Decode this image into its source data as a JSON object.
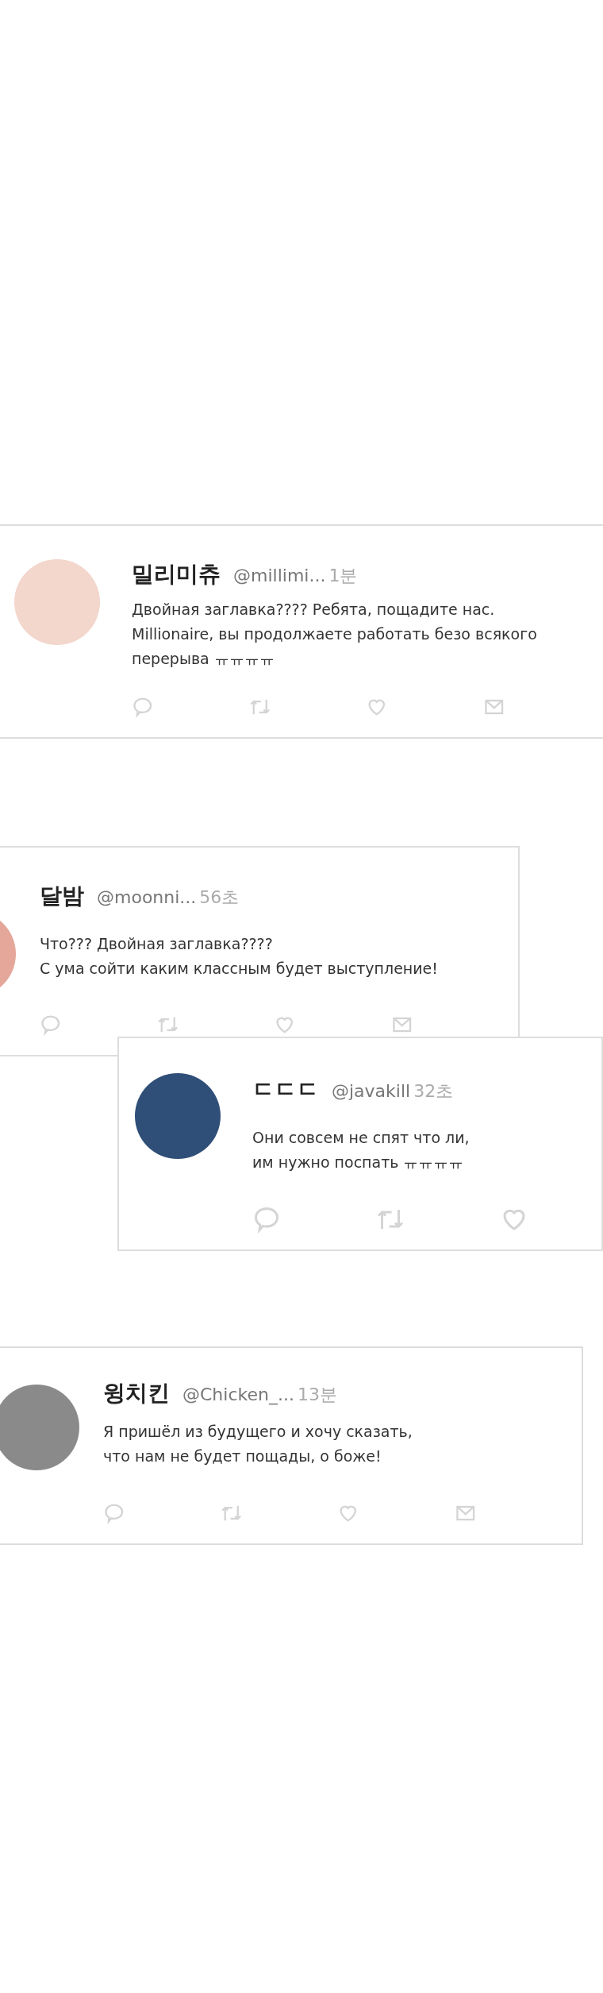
{
  "tweets": [
    {
      "name": "밀리미츄",
      "handle": "@millimi...",
      "time": "1분",
      "text": [
        "Двойная заглавка???? Ребята, пощадите нас.",
        "Millionaire, вы продолжаете работать безо всякого",
        "перерыва ㅠㅠㅠㅠ"
      ],
      "actions": [
        {
          "kind": "reply"
        },
        {
          "kind": "retweet"
        },
        {
          "kind": "like"
        },
        {
          "kind": "mail"
        }
      ]
    },
    {
      "name": "달밤",
      "handle": "@moonni...",
      "time": "56초",
      "text": [
        "Что??? Двойная заглавка????",
        "С ума сойти каким классным будет выступление!"
      ],
      "actions": [
        {
          "kind": "reply"
        },
        {
          "kind": "retweet"
        },
        {
          "kind": "like"
        },
        {
          "kind": "mail"
        }
      ]
    },
    {
      "name": "ㄷㄷㄷ",
      "handle": "@javakill",
      "time": "32초",
      "text": [
        "Они совсем не спят что ли,",
        "им нужно поспать ㅠㅠㅠㅠ"
      ],
      "actions": [
        {
          "kind": "reply"
        },
        {
          "kind": "retweet"
        },
        {
          "kind": "like"
        }
      ]
    },
    {
      "name": "윙치킨",
      "handle": "@Chicken_...",
      "time": "13분",
      "text": [
        "Я пришёл из будущего и хочу сказать,",
        "что нам не будет пощады, о боже!"
      ],
      "actions": [
        {
          "kind": "reply"
        },
        {
          "kind": "retweet"
        },
        {
          "kind": "like"
        },
        {
          "kind": "mail"
        }
      ]
    }
  ]
}
